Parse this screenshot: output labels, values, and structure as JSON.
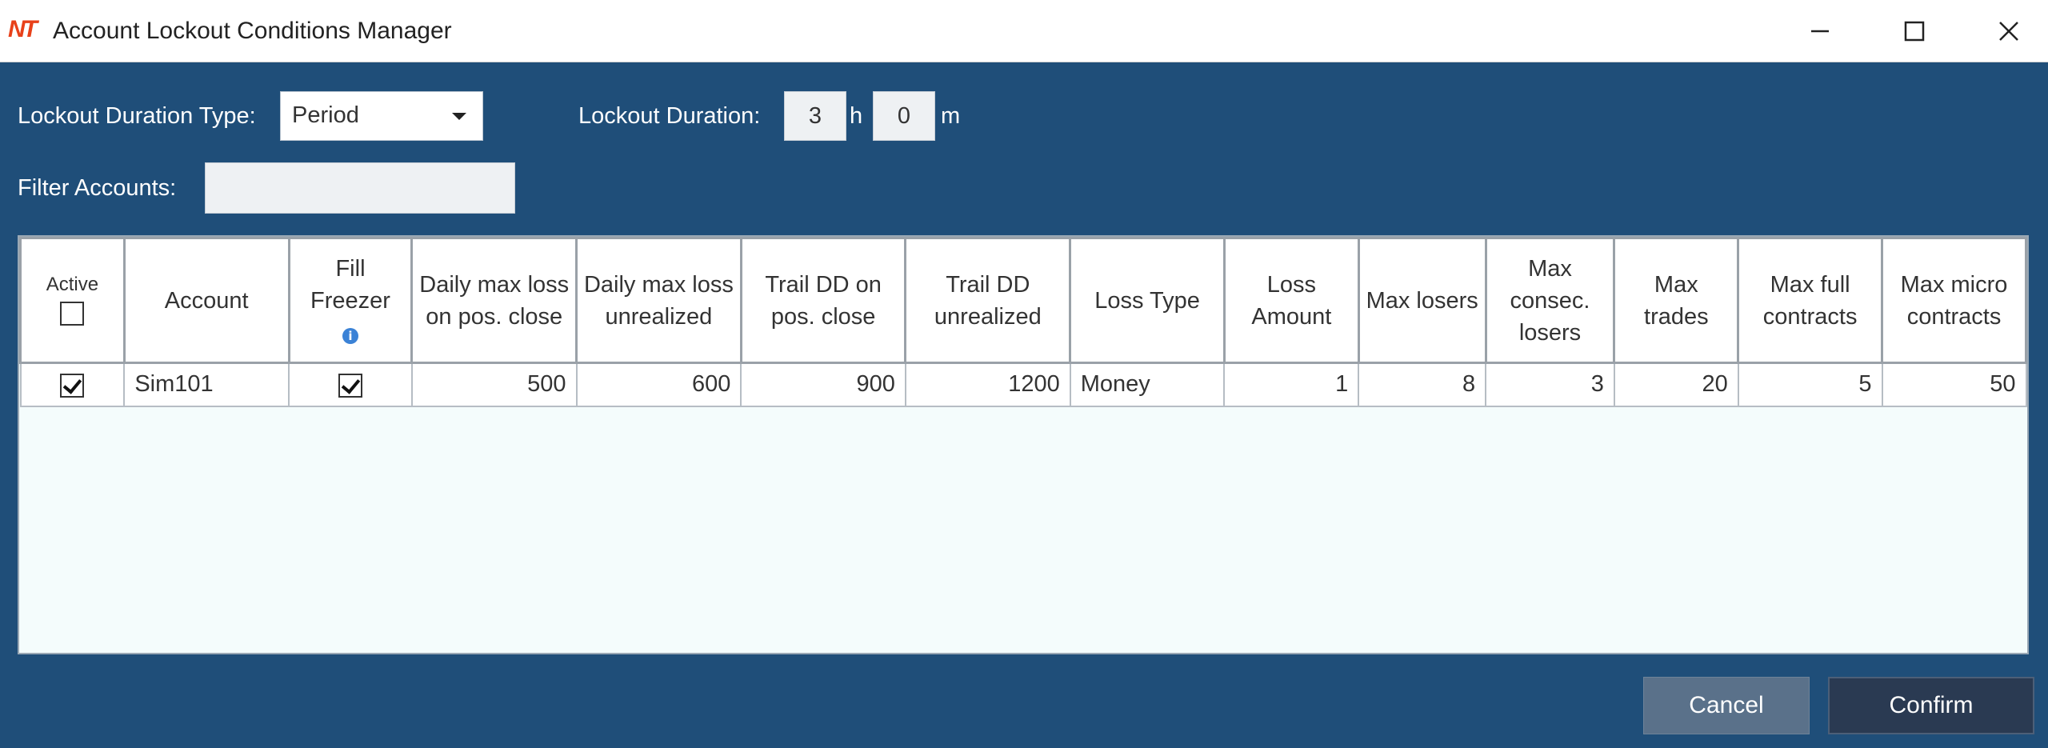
{
  "window": {
    "title": "Account Lockout Conditions Manager",
    "logo_text": "NT",
    "icons": {
      "minimize": "minimize-icon",
      "maximize": "maximize-icon",
      "close": "close-icon"
    }
  },
  "settings": {
    "duration_type_label": "Lockout Duration Type:",
    "duration_type_value": "Period",
    "duration_label": "Lockout Duration:",
    "hours_value": "3",
    "hours_unit": "h",
    "minutes_value": "0",
    "minutes_unit": "m",
    "filter_label": "Filter Accounts:",
    "filter_value": ""
  },
  "grid": {
    "headers": {
      "active": "Active",
      "account": "Account",
      "fill_freezer": "Fill Freezer",
      "daily_max_loss_close": "Daily max loss on pos. close",
      "daily_max_loss_unrealized": "Daily max loss unrealized",
      "trail_dd_close": "Trail DD on pos. close",
      "trail_dd_unrealized": "Trail DD unrealized",
      "loss_type": "Loss Type",
      "loss_amount": "Loss Amount",
      "max_losers": "Max losers",
      "max_consec_losers": "Max consec. losers",
      "max_trades": "Max trades",
      "max_full_contracts": "Max full contracts",
      "max_micro_contracts": "Max micro contracts"
    },
    "header_active_checked": false,
    "rows": [
      {
        "active": true,
        "account": "Sim101",
        "fill_freezer": true,
        "daily_max_loss_close": "500",
        "daily_max_loss_unrealized": "600",
        "trail_dd_close": "900",
        "trail_dd_unrealized": "1200",
        "loss_type": "Money",
        "loss_amount": "1",
        "max_losers": "8",
        "max_consec_losers": "3",
        "max_trades": "20",
        "max_full_contracts": "5",
        "max_micro_contracts": "50"
      }
    ]
  },
  "footer": {
    "cancel_label": "Cancel",
    "confirm_label": "Confirm"
  },
  "colors": {
    "background": "#1f4e79",
    "logo": "#e8411a",
    "info_icon": "#3b82d6",
    "confirm_button": "#2a3a52",
    "cancel_button": "#5a718a"
  }
}
